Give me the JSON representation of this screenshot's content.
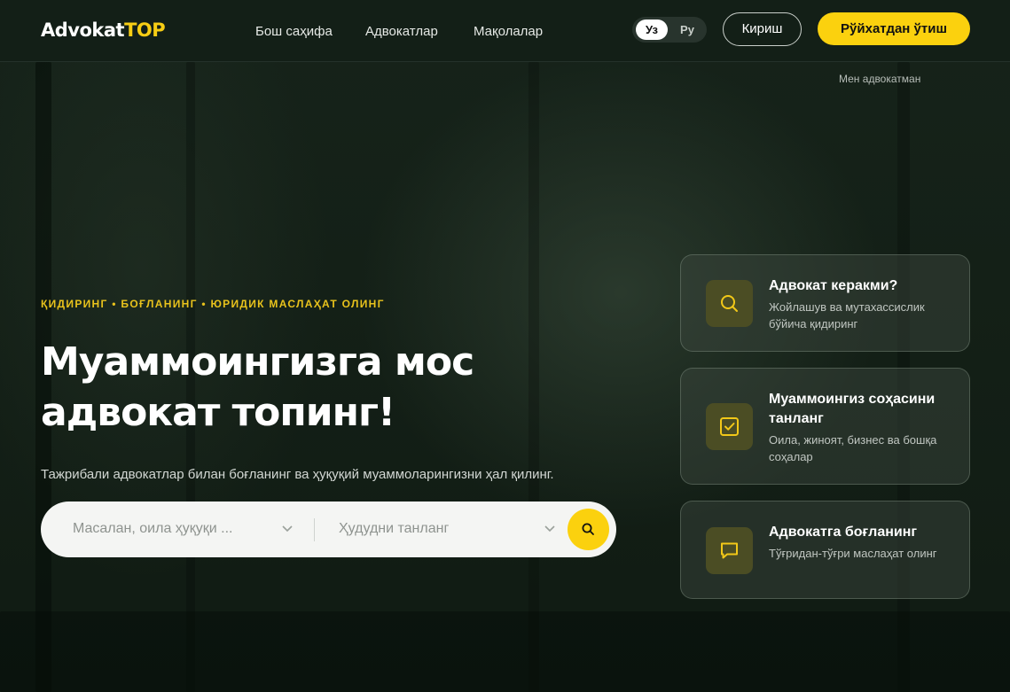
{
  "header": {
    "logo_part1": "Advokat",
    "logo_part2": "TOP",
    "nav": [
      {
        "label": "Бош саҳифа"
      },
      {
        "label": "Адвокатлар"
      },
      {
        "label": "Мақолалар"
      }
    ],
    "lang": {
      "uz": "Уз",
      "ru": "Ру",
      "active": "uz"
    },
    "login_label": "Кириш",
    "register_label": "Рўйхатдан ўтиш",
    "lawyer_link": "Мен адвокатман"
  },
  "hero": {
    "tagline": "ҚИДИРИНГ • БОҒЛАНИНГ • ЮРИДИК МАСЛАҲАТ ОЛИНГ",
    "headline": "Муаммоингизга мос адвокат топинг!",
    "subtext": "Тажрибали адвокатлар билан боғланинг ва ҳуқуқий муаммоларингизни ҳал қилинг.",
    "search": {
      "field1_placeholder": "Масалан, оила ҳуқуқи ...",
      "field2_placeholder": "Ҳудудни танланг"
    }
  },
  "cards": [
    {
      "title": "Адвокат керакми?",
      "desc": "Жойлашув ва мутахассислик бўйича қидиринг",
      "icon": "search-icon"
    },
    {
      "title": "Муаммоингиз соҳасини танланг",
      "desc": "Оила, жиноят, бизнес ва бошқа соҳалар",
      "icon": "checkbox-icon"
    },
    {
      "title": "Адвокатга боғланинг",
      "desc": "Тўғридан-тўғри маслаҳат олинг",
      "icon": "chat-icon"
    }
  ],
  "colors": {
    "accent": "#fbd10e",
    "background": "#131f17"
  }
}
